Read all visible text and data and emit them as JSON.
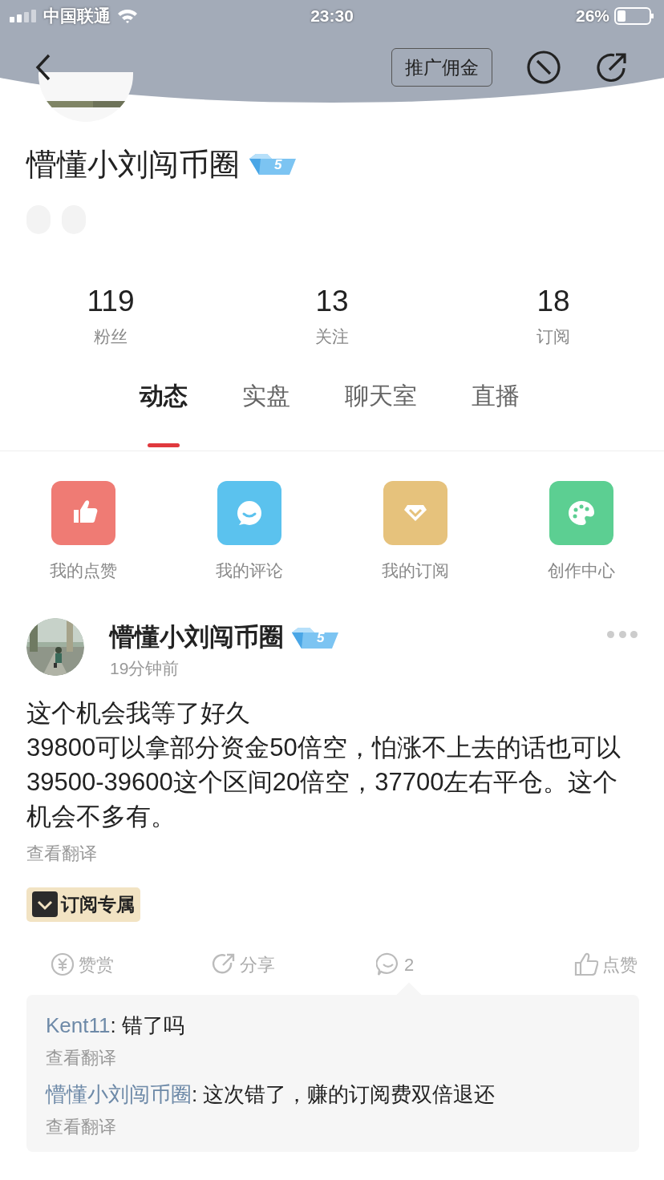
{
  "status_bar": {
    "carrier": "中国联通",
    "time": "23:30",
    "battery": "26%"
  },
  "header": {
    "promo_button": "推广佣金"
  },
  "profile": {
    "name": "懵懂小刘闯币圈",
    "level_badge": "5"
  },
  "stats": [
    {
      "value": "119",
      "label": "粉丝"
    },
    {
      "value": "13",
      "label": "关注"
    },
    {
      "value": "18",
      "label": "订阅"
    }
  ],
  "tabs": [
    {
      "label": "动态",
      "selected": true
    },
    {
      "label": "实盘",
      "selected": false
    },
    {
      "label": "聊天室",
      "selected": false
    },
    {
      "label": "直播",
      "selected": false
    }
  ],
  "shortcuts": [
    {
      "kind": "like",
      "label": "我的点赞",
      "color": "#ef7b74"
    },
    {
      "kind": "comment",
      "label": "我的评论",
      "color": "#5bc2ee"
    },
    {
      "kind": "subscribe",
      "label": "我的订阅",
      "color": "#e6c27c"
    },
    {
      "kind": "create",
      "label": "创作中心",
      "color": "#5ccf92"
    }
  ],
  "post": {
    "author": "懵懂小刘闯币圈",
    "level_badge": "5",
    "time": "19分钟前",
    "lines": [
      "这个机会我等了好久",
      "39800可以拿部分资金50倍空，怕涨不上去的话也可以39500-39600这个区间20倍空，37700左右平仓。这个机会不多有。"
    ],
    "translate": "查看翻译",
    "tag": "订阅专属",
    "actions": [
      {
        "kind": "reward",
        "label": "赞赏"
      },
      {
        "kind": "share",
        "label": "分享"
      },
      {
        "kind": "comment",
        "label": "2"
      },
      {
        "kind": "like",
        "label": "点赞"
      }
    ],
    "comments": [
      {
        "author": "Kent11",
        "text": ": 错了吗",
        "translate": "查看翻译"
      },
      {
        "author": "懵懂小刘闯币圈",
        "text": ": 这次错了，赚的订阅费双倍退还",
        "translate": "查看翻译"
      }
    ]
  }
}
